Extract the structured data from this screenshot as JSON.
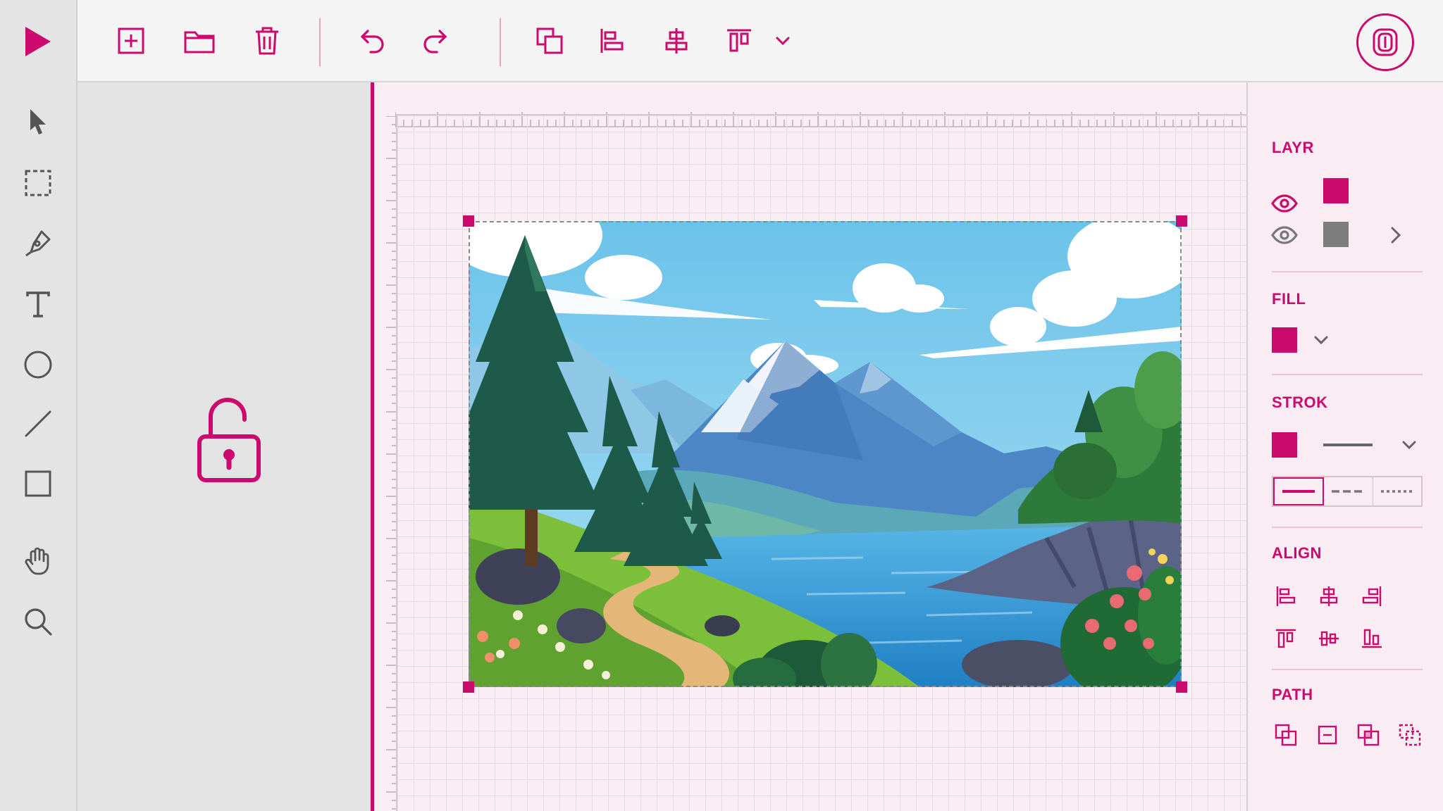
{
  "theme": {
    "accent": "#cc0a6e",
    "icon_gray": "#555555",
    "layer2_color": "#7d7d7d"
  },
  "toolbar": {
    "icons": [
      "play-icon",
      "new-file-icon",
      "open-folder-icon",
      "trash-icon",
      "undo-icon",
      "redo-icon",
      "duplicate-icon",
      "align-left-icon",
      "align-center-icon",
      "distribute-top-icon",
      "chevron-down-icon",
      "profile-icon"
    ]
  },
  "tools": [
    "select-arrow-icon",
    "marquee-select-icon",
    "pen-icon",
    "text-icon",
    "ellipse-icon",
    "line-icon",
    "rectangle-icon",
    "hand-icon",
    "zoom-icon"
  ],
  "properties": {
    "layers": {
      "title": "LAYR",
      "items": [
        {
          "visible": true,
          "color": "#cc0a6e"
        },
        {
          "visible": true,
          "color": "#7d7d7d"
        }
      ]
    },
    "fill": {
      "title": "FILL",
      "color": "#cc0a6e"
    },
    "stroke": {
      "title": "STROK",
      "color": "#cc0a6e",
      "style_options": [
        "solid",
        "dashed",
        "dotted"
      ],
      "selected_style": "solid"
    },
    "align": {
      "title": "ALIGN"
    },
    "path": {
      "title": "PATH"
    }
  }
}
